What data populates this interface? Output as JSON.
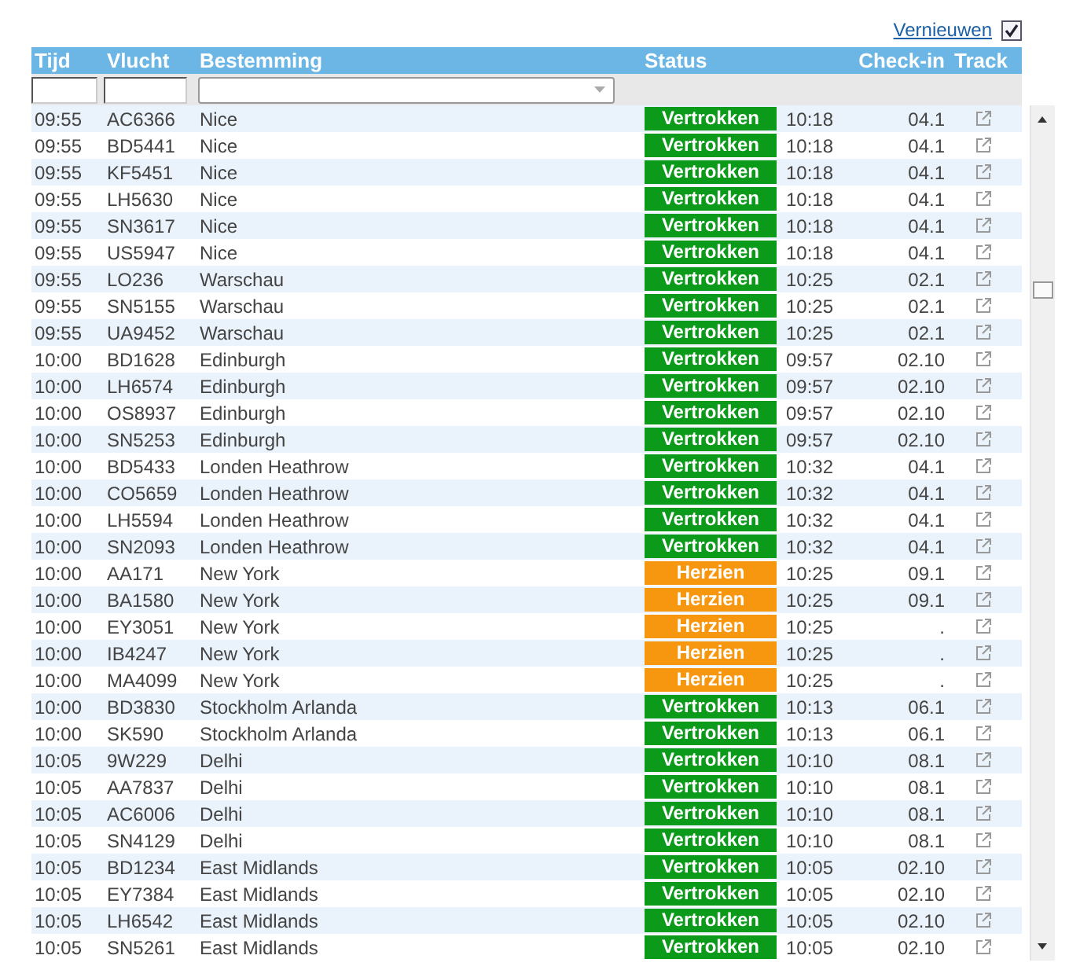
{
  "refresh": {
    "label": "Vernieuwen",
    "checked": true
  },
  "columns": [
    "Tijd",
    "Vlucht",
    "Bestemming",
    "Status",
    "Check-in",
    "Track"
  ],
  "rows": [
    {
      "time": "09:55",
      "flight": "AC6366",
      "destination": "Nice",
      "status": {
        "label": "Vertrokken",
        "kind": "departed"
      },
      "column_5": "10:18",
      "check_in": "04.1"
    },
    {
      "time": "09:55",
      "flight": "BD5441",
      "destination": "Nice",
      "status": {
        "label": "Vertrokken",
        "kind": "departed"
      },
      "column_5": "10:18",
      "check_in": "04.1"
    },
    {
      "time": "09:55",
      "flight": "KF5451",
      "destination": "Nice",
      "status": {
        "label": "Vertrokken",
        "kind": "departed"
      },
      "column_5": "10:18",
      "check_in": "04.1"
    },
    {
      "time": "09:55",
      "flight": "LH5630",
      "destination": "Nice",
      "status": {
        "label": "Vertrokken",
        "kind": "departed"
      },
      "column_5": "10:18",
      "check_in": "04.1"
    },
    {
      "time": "09:55",
      "flight": "SN3617",
      "destination": "Nice",
      "status": {
        "label": "Vertrokken",
        "kind": "departed"
      },
      "column_5": "10:18",
      "check_in": "04.1"
    },
    {
      "time": "09:55",
      "flight": "US5947",
      "destination": "Nice",
      "status": {
        "label": "Vertrokken",
        "kind": "departed"
      },
      "column_5": "10:18",
      "check_in": "04.1"
    },
    {
      "time": "09:55",
      "flight": "LO236",
      "destination": "Warschau",
      "status": {
        "label": "Vertrokken",
        "kind": "departed"
      },
      "column_5": "10:25",
      "check_in": "02.1"
    },
    {
      "time": "09:55",
      "flight": "SN5155",
      "destination": "Warschau",
      "status": {
        "label": "Vertrokken",
        "kind": "departed"
      },
      "column_5": "10:25",
      "check_in": "02.1"
    },
    {
      "time": "09:55",
      "flight": "UA9452",
      "destination": "Warschau",
      "status": {
        "label": "Vertrokken",
        "kind": "departed"
      },
      "column_5": "10:25",
      "check_in": "02.1"
    },
    {
      "time": "10:00",
      "flight": "BD1628",
      "destination": "Edinburgh",
      "status": {
        "label": "Vertrokken",
        "kind": "departed"
      },
      "column_5": "09:57",
      "check_in": "02.10"
    },
    {
      "time": "10:00",
      "flight": "LH6574",
      "destination": "Edinburgh",
      "status": {
        "label": "Vertrokken",
        "kind": "departed"
      },
      "column_5": "09:57",
      "check_in": "02.10"
    },
    {
      "time": "10:00",
      "flight": "OS8937",
      "destination": "Edinburgh",
      "status": {
        "label": "Vertrokken",
        "kind": "departed"
      },
      "column_5": "09:57",
      "check_in": "02.10"
    },
    {
      "time": "10:00",
      "flight": "SN5253",
      "destination": "Edinburgh",
      "status": {
        "label": "Vertrokken",
        "kind": "departed"
      },
      "column_5": "09:57",
      "check_in": "02.10"
    },
    {
      "time": "10:00",
      "flight": "BD5433",
      "destination": "Londen Heathrow",
      "status": {
        "label": "Vertrokken",
        "kind": "departed"
      },
      "column_5": "10:32",
      "check_in": "04.1"
    },
    {
      "time": "10:00",
      "flight": "CO5659",
      "destination": "Londen Heathrow",
      "status": {
        "label": "Vertrokken",
        "kind": "departed"
      },
      "column_5": "10:32",
      "check_in": "04.1"
    },
    {
      "time": "10:00",
      "flight": "LH5594",
      "destination": "Londen Heathrow",
      "status": {
        "label": "Vertrokken",
        "kind": "departed"
      },
      "column_5": "10:32",
      "check_in": "04.1"
    },
    {
      "time": "10:00",
      "flight": "SN2093",
      "destination": "Londen Heathrow",
      "status": {
        "label": "Vertrokken",
        "kind": "departed"
      },
      "column_5": "10:32",
      "check_in": "04.1"
    },
    {
      "time": "10:00",
      "flight": "AA171",
      "destination": "New York",
      "status": {
        "label": "Herzien",
        "kind": "revised"
      },
      "column_5": "10:25",
      "check_in": "09.1"
    },
    {
      "time": "10:00",
      "flight": "BA1580",
      "destination": "New York",
      "status": {
        "label": "Herzien",
        "kind": "revised"
      },
      "column_5": "10:25",
      "check_in": "09.1"
    },
    {
      "time": "10:00",
      "flight": "EY3051",
      "destination": "New York",
      "status": {
        "label": "Herzien",
        "kind": "revised"
      },
      "column_5": "10:25",
      "check_in": "."
    },
    {
      "time": "10:00",
      "flight": "IB4247",
      "destination": "New York",
      "status": {
        "label": "Herzien",
        "kind": "revised"
      },
      "column_5": "10:25",
      "check_in": "."
    },
    {
      "time": "10:00",
      "flight": "MA4099",
      "destination": "New York",
      "status": {
        "label": "Herzien",
        "kind": "revised"
      },
      "column_5": "10:25",
      "check_in": "."
    },
    {
      "time": "10:00",
      "flight": "BD3830",
      "destination": "Stockholm Arlanda",
      "status": {
        "label": "Vertrokken",
        "kind": "departed"
      },
      "column_5": "10:13",
      "check_in": "06.1"
    },
    {
      "time": "10:00",
      "flight": "SK590",
      "destination": "Stockholm Arlanda",
      "status": {
        "label": "Vertrokken",
        "kind": "departed"
      },
      "column_5": "10:13",
      "check_in": "06.1"
    },
    {
      "time": "10:05",
      "flight": "9W229",
      "destination": "Delhi",
      "status": {
        "label": "Vertrokken",
        "kind": "departed"
      },
      "column_5": "10:10",
      "check_in": "08.1"
    },
    {
      "time": "10:05",
      "flight": "AA7837",
      "destination": "Delhi",
      "status": {
        "label": "Vertrokken",
        "kind": "departed"
      },
      "column_5": "10:10",
      "check_in": "08.1"
    },
    {
      "time": "10:05",
      "flight": "AC6006",
      "destination": "Delhi",
      "status": {
        "label": "Vertrokken",
        "kind": "departed"
      },
      "column_5": "10:10",
      "check_in": "08.1"
    },
    {
      "time": "10:05",
      "flight": "SN4129",
      "destination": "Delhi",
      "status": {
        "label": "Vertrokken",
        "kind": "departed"
      },
      "column_5": "10:10",
      "check_in": "08.1"
    },
    {
      "time": "10:05",
      "flight": "BD1234",
      "destination": "East Midlands",
      "status": {
        "label": "Vertrokken",
        "kind": "departed"
      },
      "column_5": "10:05",
      "check_in": "02.10"
    },
    {
      "time": "10:05",
      "flight": "EY7384",
      "destination": "East Midlands",
      "status": {
        "label": "Vertrokken",
        "kind": "departed"
      },
      "column_5": "10:05",
      "check_in": "02.10"
    },
    {
      "time": "10:05",
      "flight": "LH6542",
      "destination": "East Midlands",
      "status": {
        "label": "Vertrokken",
        "kind": "departed"
      },
      "column_5": "10:05",
      "check_in": "02.10"
    },
    {
      "time": "10:05",
      "flight": "SN5261",
      "destination": "East Midlands",
      "status": {
        "label": "Vertrokken",
        "kind": "departed"
      },
      "column_5": "10:05",
      "check_in": "02.10"
    }
  ]
}
